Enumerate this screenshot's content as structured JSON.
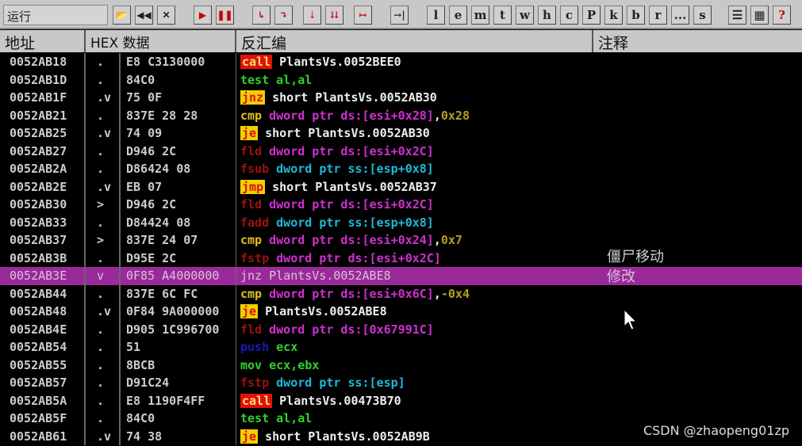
{
  "toolbar": {
    "status": "运行",
    "buttons": [
      "open",
      "rewind",
      "close",
      "run",
      "pause",
      "step-into",
      "step-over",
      "trace-into",
      "trace-over",
      "execute-till-return",
      "goto"
    ],
    "letters": [
      "l",
      "e",
      "m",
      "t",
      "w",
      "h",
      "c",
      "P",
      "k",
      "b",
      "r",
      "...",
      "s"
    ],
    "right": [
      "list",
      "window",
      "?"
    ]
  },
  "header": {
    "addr": "地址",
    "hex": "HEX 数据",
    "dis": "反汇编",
    "comment": "注释"
  },
  "rows": [
    {
      "a": "0052AB18",
      "m": ".",
      "h": "E8 C3130000",
      "d": [
        [
          "call",
          "call"
        ],
        [
          " PlantsVs.0052BEE0",
          "wh"
        ]
      ]
    },
    {
      "a": "0052AB1D",
      "m": ".",
      "h": "84C0",
      "d": [
        [
          "test al,al",
          "test"
        ]
      ]
    },
    {
      "a": "0052AB1F",
      "m": ".v",
      "h": "75 0F",
      "d": [
        [
          "jnz",
          "jcc"
        ],
        [
          " short PlantsVs.0052AB30",
          "wh"
        ]
      ]
    },
    {
      "a": "0052AB21",
      "m": ".",
      "h": "837E 28 28",
      "d": [
        [
          "cmp",
          "cmp"
        ],
        [
          " dword ptr ds:[esi+0x28]",
          "mem"
        ],
        [
          ",",
          "wh"
        ],
        [
          "0x28",
          "imm"
        ]
      ]
    },
    {
      "a": "0052AB25",
      "m": ".v",
      "h": "74 09",
      "d": [
        [
          "je",
          "jcc"
        ],
        [
          " short PlantsVs.0052AB30",
          "wh"
        ]
      ]
    },
    {
      "a": "0052AB27",
      "m": ".",
      "h": "D946 2C",
      "d": [
        [
          "fld",
          "fpu"
        ],
        [
          " dword ptr ds:[esi+0x2C]",
          "mem"
        ]
      ]
    },
    {
      "a": "0052AB2A",
      "m": ".",
      "h": "D86424 08",
      "d": [
        [
          "fsub",
          "fpu"
        ],
        [
          " dword ptr ss:[esp+0x8]",
          "seg"
        ]
      ]
    },
    {
      "a": "0052AB2E",
      "m": ".v",
      "h": "EB 07",
      "d": [
        [
          "jmp",
          "jcc"
        ],
        [
          " short PlantsVs.0052AB37",
          "wh"
        ]
      ]
    },
    {
      "a": "0052AB30",
      "m": ">",
      "h": "D946 2C",
      "d": [
        [
          "fld",
          "fpu"
        ],
        [
          " dword ptr ds:[esi+0x2C]",
          "mem"
        ]
      ]
    },
    {
      "a": "0052AB33",
      "m": ".",
      "h": "D84424 08",
      "d": [
        [
          "fadd",
          "fpu"
        ],
        [
          " dword ptr ss:[esp+0x8]",
          "seg"
        ]
      ]
    },
    {
      "a": "0052AB37",
      "m": ">",
      "h": "837E 24 07",
      "d": [
        [
          "cmp",
          "cmp"
        ],
        [
          " dword ptr ds:[esi+0x24]",
          "mem"
        ],
        [
          ",",
          "wh"
        ],
        [
          "0x7",
          "imm"
        ]
      ]
    },
    {
      "a": "0052AB3B",
      "m": ".",
      "h": "D95E 2C",
      "d": [
        [
          "fstp",
          "fpu"
        ],
        [
          " dword ptr ds:[esi+0x2C]",
          "mem"
        ]
      ],
      "comment": "僵尸移动"
    },
    {
      "a": "0052AB3E",
      "m": "v",
      "h": "0F85 A4000000",
      "d": [
        [
          "jnz PlantsVs.0052ABE8",
          "wh"
        ]
      ],
      "sel": true,
      "comment": "修改"
    },
    {
      "a": "0052AB44",
      "m": ".",
      "h": "837E 6C FC",
      "d": [
        [
          "cmp",
          "cmp"
        ],
        [
          " dword ptr ds:[esi+0x6C]",
          "mem"
        ],
        [
          ",",
          "wh"
        ],
        [
          "-0x4",
          "imm"
        ]
      ]
    },
    {
      "a": "0052AB48",
      "m": ".v",
      "h": "0F84 9A000000",
      "d": [
        [
          "je",
          "jcc"
        ],
        [
          " PlantsVs.0052ABE8",
          "wh"
        ]
      ]
    },
    {
      "a": "0052AB4E",
      "m": ".",
      "h": "D905 1C996700",
      "d": [
        [
          "fld",
          "fpu"
        ],
        [
          " dword ptr ds:[0x67991C]",
          "mem"
        ]
      ]
    },
    {
      "a": "0052AB54",
      "m": ".",
      "h": "51",
      "d": [
        [
          "push",
          "push"
        ],
        [
          " ecx",
          "reg"
        ]
      ]
    },
    {
      "a": "0052AB55",
      "m": ".",
      "h": "8BCB",
      "d": [
        [
          "mov ecx,ebx",
          "reg"
        ]
      ]
    },
    {
      "a": "0052AB57",
      "m": ".",
      "h": "D91C24",
      "d": [
        [
          "fstp",
          "fpu"
        ],
        [
          " dword ptr ss:[esp]",
          "seg"
        ]
      ]
    },
    {
      "a": "0052AB5A",
      "m": ".",
      "h": "E8 1190F4FF",
      "d": [
        [
          "call",
          "call"
        ],
        [
          " PlantsVs.00473B70",
          "wh"
        ]
      ]
    },
    {
      "a": "0052AB5F",
      "m": ".",
      "h": "84C0",
      "d": [
        [
          "test al,al",
          "test"
        ]
      ]
    },
    {
      "a": "0052AB61",
      "m": ".v",
      "h": "74 38",
      "d": [
        [
          "je",
          "jcc"
        ],
        [
          " short PlantsVs.0052AB9B",
          "wh"
        ]
      ]
    }
  ],
  "watermark": "CSDN @zhaopeng01zp"
}
